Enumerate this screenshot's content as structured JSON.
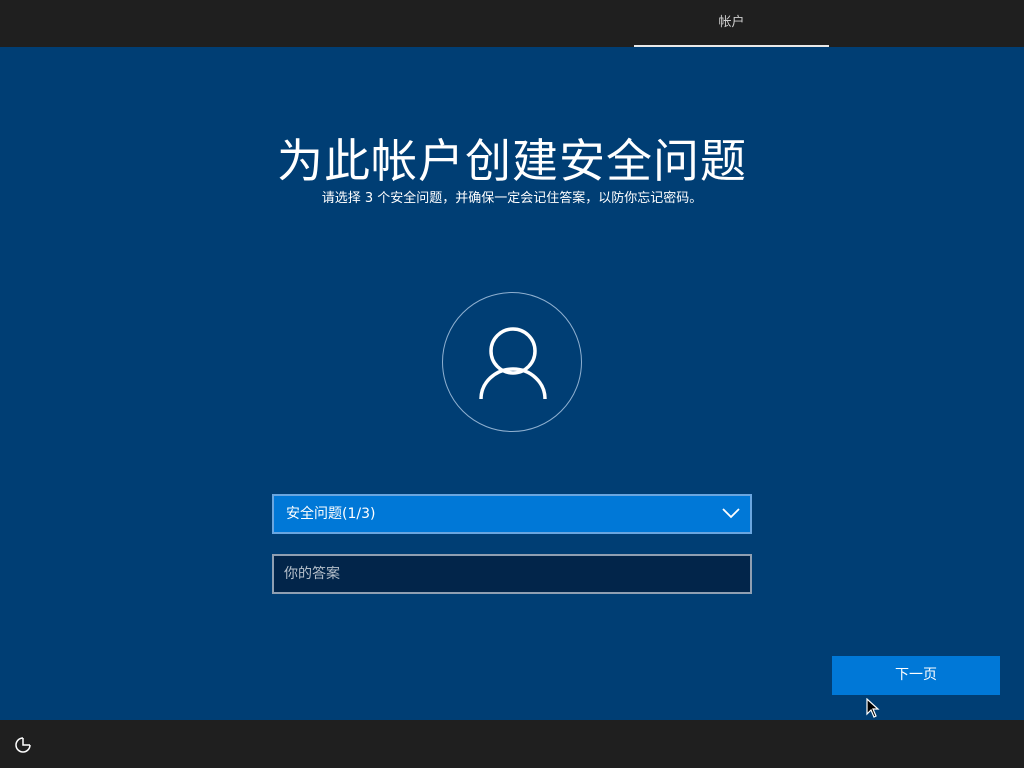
{
  "header": {
    "tab_label": "帐户"
  },
  "main": {
    "title": "为此帐户创建安全问题",
    "subtitle": "请选择 3 个安全问题，并确保一定会记住答案，以防你忘记密码。",
    "avatar_icon": "user-icon",
    "question_select": {
      "selected": "安全问题(1/3)"
    },
    "answer_field": {
      "placeholder": "你的答案",
      "value": ""
    },
    "next_button_label": "下一页"
  },
  "footer": {
    "accessibility_icon": "ease-of-access-icon"
  },
  "colors": {
    "background": "#003e74",
    "accent": "#0078d7",
    "bar": "#1f1f1f"
  }
}
